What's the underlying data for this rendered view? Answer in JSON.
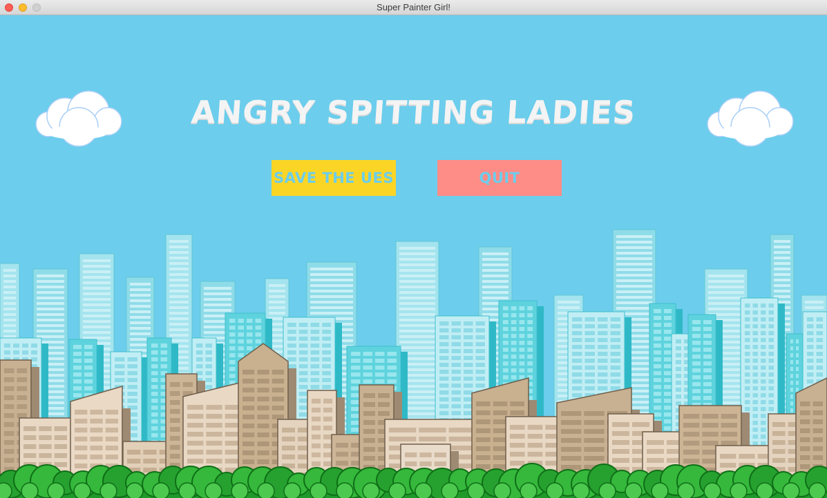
{
  "window": {
    "title": "Super Painter Girl!"
  },
  "game": {
    "title": "ANGRY SPITTING LADIES",
    "buttons": {
      "start_label": "SAVE THE UES",
      "quit_label": "QUIT"
    }
  },
  "colors": {
    "sky": "#6ccdec",
    "title_text": "#f4f4f4",
    "start_button": "#fbd526",
    "quit_button": "#fe8c87",
    "button_text": "#6ccdec",
    "bush": "#2ea832"
  }
}
